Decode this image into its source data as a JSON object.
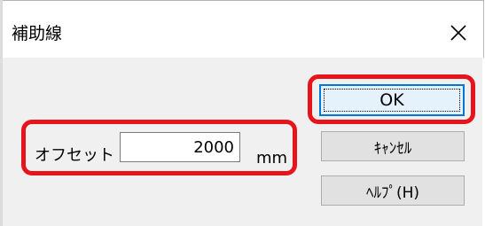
{
  "window": {
    "title": "補助線",
    "close_icon": "close-icon"
  },
  "offset": {
    "label": "オフセット",
    "value": "2000",
    "unit": "mm"
  },
  "buttons": {
    "ok_label": "OK",
    "cancel_label": "ｷｬﾝｾﾙ",
    "help_label": "ﾍﾙﾌﾟ(H)"
  },
  "colors": {
    "highlight": "#e8141c",
    "default_button_border": "#0078d7",
    "client_background": "#f0f0f0"
  }
}
